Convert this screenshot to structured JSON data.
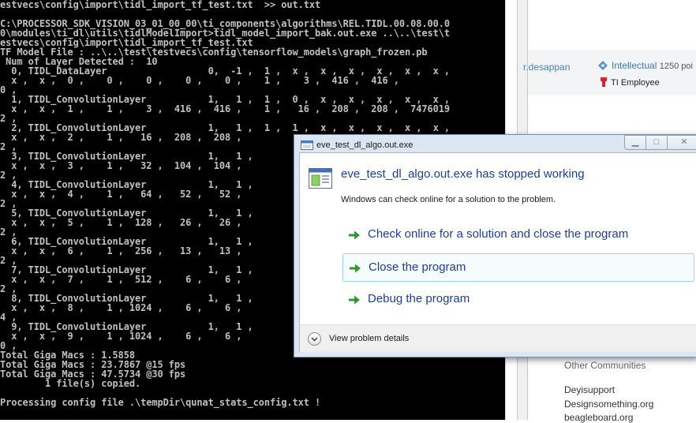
{
  "console": {
    "lines": [
      "estvecs\\config\\import\\tidl_import_tf_test.txt  >> out.txt",
      "",
      "C:\\PROCESSOR_SDK_VISION_03_01_00_00\\ti_components\\algorithms\\REL.TIDL.00.08.00.0",
      "0\\modules\\ti_dl\\utils\\tidlModelImport>tidl_model_import_bak.out.exe ..\\..\\test\\t",
      "estvecs\\config\\import\\tidl_import_tf_test.txt",
      "TF Model File : ..\\..\\test\\testvecs\\config\\tensorflow_models\\graph_frozen.pb",
      " Num of Layer Detected :  10",
      "  0, TIDL_DataLayer                  0,  -1 ,  1 ,  x ,  x ,  x ,  x ,  x ,  x ,",
      "  x ,  x ,  0 ,    0 ,    0 ,    0 ,    0 ,    1 ,    3 ,  416 ,  416 ,",
      "0 ,",
      "  1, TIDL_ConvolutionLayer           1,   1 ,  1 ,  0 ,  x ,  x ,  x ,  x ,  x ,",
      "  x ,  x ,  1 ,    1 ,    3 ,  416 ,  416 ,    1 ,   16 ,  208 ,  208 ,  7476019",
      "2 ,",
      "  2, TIDL_ConvolutionLayer           1,   1 ,  1 ,  1 ,  x ,  x ,  x ,  x ,  x ,",
      "  x ,  x ,  2 ,    1 ,   16 ,  208 ,  208 ,",
      "2 ,",
      "  3, TIDL_ConvolutionLayer           1,   1 ,",
      "  x ,  x ,  3 ,    1 ,   32 ,  104 ,  104 ,",
      "2 ,",
      "  4, TIDL_ConvolutionLayer           1,   1 ,",
      "  x ,  x ,  4 ,    1 ,   64 ,   52 ,   52 ,",
      "2 ,",
      "  5, TIDL_ConvolutionLayer           1,   1 ,",
      "  x ,  x ,  5 ,    1 ,  128 ,   26 ,   26 ,",
      "2 ,",
      "  6, TIDL_ConvolutionLayer           1,   1 ,",
      "  x ,  x ,  6 ,    1 ,  256 ,   13 ,   13 ,",
      "2 ,",
      "  7, TIDL_ConvolutionLayer           1,   1 ,",
      "  x ,  x ,  7 ,    1 ,  512 ,    6 ,    6 ,",
      "2 ,",
      "  8, TIDL_ConvolutionLayer           1,   1 ,",
      "  x ,  x ,  8 ,    1 , 1024 ,    6 ,    6 ,",
      "4 ,",
      "  9, TIDL_ConvolutionLayer           1,   1 ,",
      "  x ,  x ,  9 ,    1 , 1024 ,    6 ,    6 ,",
      "0 ,",
      "Total Giga Macs : 1.5858",
      "Total Giga Macs : 23.7867 @15 fps",
      "Total Giga Macs : 47.5734 @30 fps",
      "        1 file(s) copied.",
      "",
      "Processing config file .\\tempDir\\qunat_stats_config.txt !"
    ]
  },
  "web": {
    "user_fragment": "r.desappan",
    "rank": "Intellectual",
    "points": "1250 poi",
    "employee_badge": "TI Employee",
    "other_communities_heading": "Other Communities",
    "links": [
      "Deyisupport",
      "Designsomething.org",
      "beagleboard.org"
    ]
  },
  "dialog": {
    "title": "eve_test_dl_algo.out.exe",
    "headline": "eve_test_dl_algo.out.exe has stopped working",
    "subtext": "Windows can check online for a solution to the problem.",
    "commands": [
      "Check online for a solution and close the program",
      "Close the program",
      "Debug the program"
    ],
    "details_label": "View problem details",
    "controls": {
      "minimize": "▁",
      "maximize": "□",
      "close": "✕"
    }
  },
  "colors": {
    "console_bg": "#000000",
    "console_text": "#c0c0c0",
    "link_blue": "#1c3f95",
    "arrow_green": "#2e9a2e",
    "dialog_frame": "#dbe6f2"
  },
  "icons": {
    "dialog_title": "app-window-icon",
    "dialog_app": "program-icon",
    "command_arrow": "green-arrow-icon",
    "details": "chevron-down-icon",
    "rank": "rank-icon",
    "employee": "ti-logo-icon"
  }
}
